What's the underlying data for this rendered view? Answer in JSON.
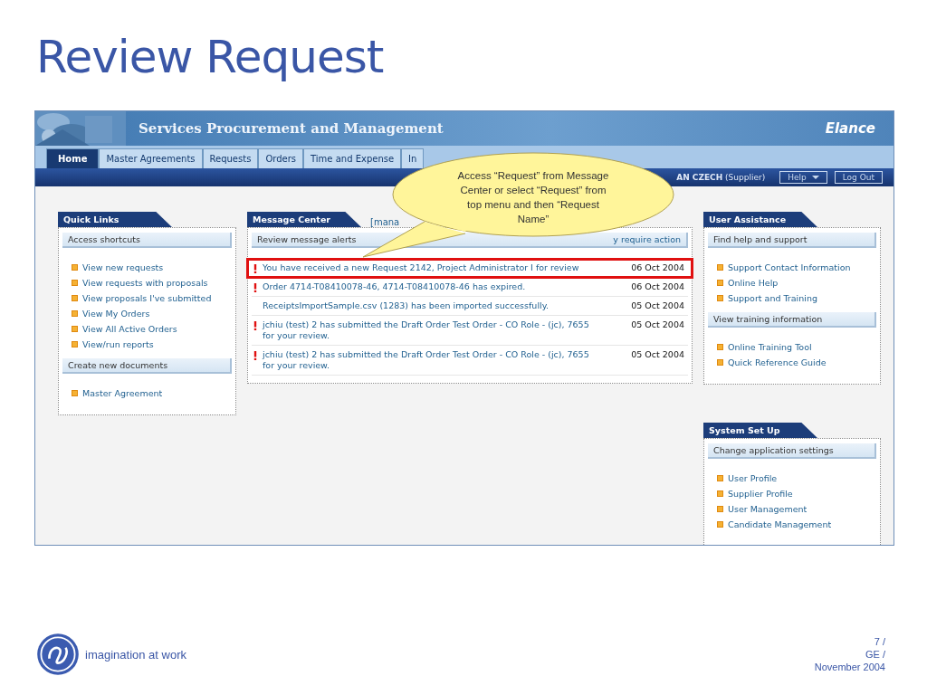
{
  "slide": {
    "title": "Review Request"
  },
  "app": {
    "title": "Services Procurement and Management",
    "brand": "Elance",
    "tabs": [
      {
        "label": "Home",
        "selected": true
      },
      {
        "label": "Master Agreements",
        "selected": false
      },
      {
        "label": "Requests",
        "selected": false
      },
      {
        "label": "Orders",
        "selected": false
      },
      {
        "label": "Time and Expense",
        "selected": false
      },
      {
        "label": "In",
        "selected": false
      }
    ],
    "user": {
      "name": "AN CZECH",
      "role": "(Supplier)"
    },
    "buttons": [
      {
        "label": "Help",
        "kind": "dropdown"
      },
      {
        "label": "Log Out",
        "kind": "plain"
      }
    ]
  },
  "quick_links": {
    "title": "Quick Links",
    "sections": [
      {
        "heading": "Access shortcuts",
        "links": [
          "View new requests",
          "View requests with proposals",
          "View proposals I've submitted",
          "View My Orders",
          "View All Active Orders",
          "View/run reports"
        ]
      },
      {
        "heading": "Create new documents",
        "links": [
          "Master Agreement"
        ]
      }
    ]
  },
  "message_center": {
    "title": "Message Center",
    "manage_link": "[mana",
    "subheading": "Review message alerts",
    "subheading_right": "y require action",
    "messages": [
      {
        "text": "You have received a new Request 2142, Project Administrator I for review",
        "date": "06 Oct 2004",
        "alert": true,
        "highlighted": true
      },
      {
        "text": "Order 4714-T08410078-46, 4714-T08410078-46 has expired.",
        "date": "06 Oct 2004",
        "alert": true,
        "highlighted": false
      },
      {
        "text": "ReceiptsImportSample.csv (1283) has been imported successfully.",
        "date": "05 Oct 2004",
        "alert": false,
        "highlighted": false
      },
      {
        "text": "jchiu (test) 2 has submitted the Draft Order Test Order - CO Role - (jc), 7655 for your review.",
        "date": "05 Oct 2004",
        "alert": true,
        "highlighted": false
      },
      {
        "text": "jchiu (test) 2 has submitted the Draft Order Test Order - CO Role - (jc), 7655 for your review.",
        "date": "05 Oct 2004",
        "alert": true,
        "highlighted": false
      }
    ]
  },
  "right_panels": [
    {
      "title": "User Assistance",
      "sections": [
        {
          "heading": "Find help and support",
          "links": [
            "Support Contact Information",
            "Online Help",
            "Support and Training"
          ]
        },
        {
          "heading": "View training information",
          "links": [
            "Online Training Tool",
            "Quick Reference Guide"
          ]
        }
      ]
    },
    {
      "title": "System Set Up",
      "sections": [
        {
          "heading": "Change application settings",
          "links": [
            "User Profile",
            "Supplier Profile",
            "User Management",
            "Candidate Management"
          ]
        }
      ]
    }
  ],
  "callout": {
    "lines": [
      "Access “Request” from Message",
      "Center or select “Request” from",
      "top menu and  then “Request",
      "Name”"
    ]
  },
  "footer": {
    "tagline": "imagination at work",
    "page": [
      "7 /",
      "GE /",
      "November 2004"
    ]
  }
}
